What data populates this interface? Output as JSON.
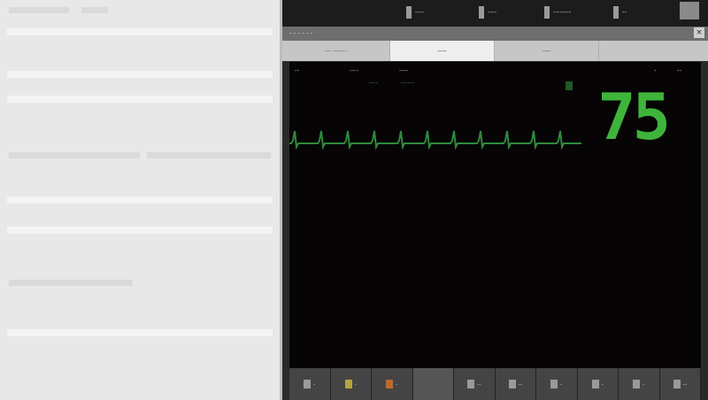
{
  "topbar": {
    "items": [
      {
        "label": "----",
        "icon": "menu-icon"
      },
      {
        "label": "----",
        "icon": "settings-icon"
      },
      {
        "label": "--------",
        "icon": "battery-icon"
      },
      {
        "label": "--",
        "icon": "signal-icon"
      }
    ]
  },
  "window": {
    "title": "- - - - - -",
    "close_label": "×"
  },
  "tabs": [
    {
      "label": "--- ------",
      "active": false
    },
    {
      "label": "----",
      "active": true
    },
    {
      "label": "----",
      "active": false
    }
  ],
  "monitor": {
    "header_left": "--",
    "header_mid1": "----",
    "header_mid2": "----",
    "sub1": "----",
    "sub2": "------",
    "header_right1": "-",
    "header_right2": "--",
    "heart_rate": "75",
    "trace_color": "#2f8a3c",
    "hr_color": "#3eb53a"
  },
  "toolbar": {
    "buttons": [
      {
        "label": "-",
        "icon": "pause-icon"
      },
      {
        "label": "-",
        "icon": "alarm-icon"
      },
      {
        "label": "-",
        "icon": "record-icon"
      },
      {
        "label": "",
        "icon": "blank-icon"
      },
      {
        "label": "--",
        "icon": "nibp-icon"
      },
      {
        "label": "--",
        "icon": "review-icon"
      },
      {
        "label": "-",
        "icon": "trend-icon"
      },
      {
        "label": "-",
        "icon": "freeze-icon"
      },
      {
        "label": "-",
        "icon": "print-icon"
      },
      {
        "label": "--",
        "icon": "menu-icon"
      }
    ]
  }
}
